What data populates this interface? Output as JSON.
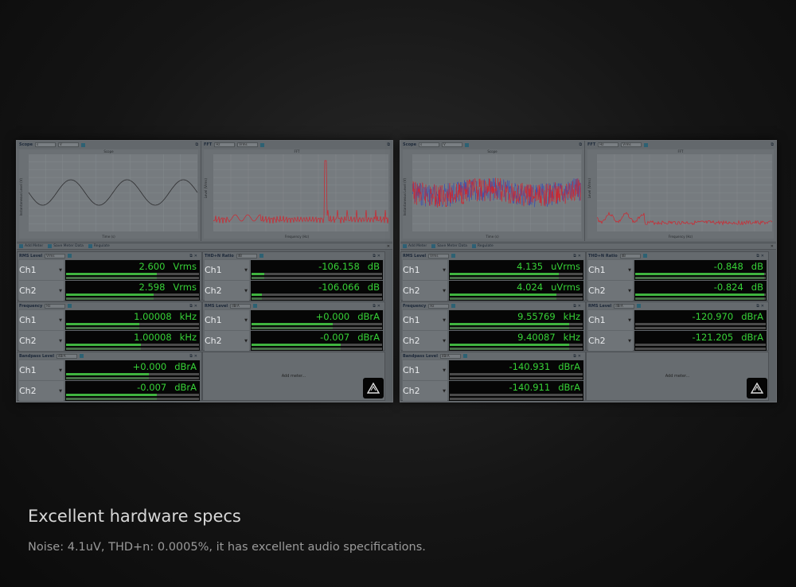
{
  "caption": {
    "title": "Excellent hardware specs",
    "subtitle": "Noise: 4.1uV, THD+n: 0.0005%,  it has excellent audio specifications."
  },
  "colors": {
    "meter_green": "#37d237",
    "bar_green": "#3fb43f",
    "trace_red": "#d0252e",
    "trace_blue": "#3a4fb0"
  },
  "toolbar": {
    "add_meter": "Add Meter",
    "save_meter_data": "Save Meter Data",
    "regulate": "Regulate"
  },
  "add_meter_placeholder": "Add meter...",
  "panels": [
    {
      "scope": {
        "title": "Scope",
        "unit1": "s",
        "unit2": "V",
        "chart_title": "Scope",
        "xlabel": "Time (s)",
        "ylabel": "Instantaneous Level (V)"
      },
      "fft": {
        "title": "FFT",
        "unit1": "Hz",
        "unit2": "Vrms",
        "chart_title": "FFT",
        "xlabel": "Frequency (Hz)",
        "ylabel": "Level (Vrms)"
      },
      "meters": {
        "rms": {
          "title": "RMS Level",
          "unit": "Vrms",
          "ch1": "2.600",
          "ch1_unit": "Vrms",
          "ch2": "2.598",
          "ch2_unit": "Vrms",
          "fill1": 0.68,
          "fill2": 0.66
        },
        "thd": {
          "title": "THD+N Ratio",
          "unit": "dB",
          "ch1": "-106.158",
          "ch1_unit": "dB",
          "ch2": "-106.066",
          "ch2_unit": "dB",
          "fill1": 0.1,
          "fill2": 0.08
        },
        "freq": {
          "title": "Frequency",
          "unit": "Hz",
          "ch1": "1.00008",
          "ch1_unit": "kHz",
          "ch2": "1.00008",
          "ch2_unit": "kHz",
          "fill1": 0.55,
          "fill2": 0.56
        },
        "rms2": {
          "title": "RMS Level",
          "unit": "dBrA",
          "ch1": "+0.000",
          "ch1_unit": "dBrA",
          "ch2": "-0.007",
          "ch2_unit": "dBrA",
          "fill1": 0.62,
          "fill2": 0.68
        },
        "bandpass": {
          "title": "Bandpass Level",
          "unit": "dBrA",
          "ch1": "+0.000",
          "ch1_unit": "dBrA",
          "ch2": "-0.007",
          "ch2_unit": "dBrA",
          "fill1": 0.62,
          "fill2": 0.68
        }
      }
    },
    {
      "scope": {
        "title": "Scope",
        "unit1": "s",
        "unit2": "V",
        "chart_title": "Scope",
        "xlabel": "Time (s)",
        "ylabel": "Instantaneous Level (V)"
      },
      "fft": {
        "title": "FFT",
        "unit1": "Hz",
        "unit2": "Vrms",
        "chart_title": "FFT",
        "xlabel": "Frequency (Hz)",
        "ylabel": "Level (Vrms)"
      },
      "meters": {
        "rms": {
          "title": "RMS Level",
          "unit": "Vrms",
          "ch1": "4.135",
          "ch1_unit": "uVrms",
          "ch2": "4.024",
          "ch2_unit": "uVrms",
          "fill1": 0.82,
          "fill2": 0.8
        },
        "thd": {
          "title": "THD+N Ratio",
          "unit": "dB",
          "ch1": "-0.848",
          "ch1_unit": "dB",
          "ch2": "-0.824",
          "ch2_unit": "dB",
          "fill1": 0.99,
          "fill2": 0.99
        },
        "freq": {
          "title": "Frequency",
          "unit": "Hz",
          "ch1": "9.55769",
          "ch1_unit": "kHz",
          "ch2": "9.40087",
          "ch2_unit": "kHz",
          "fill1": 0.9,
          "fill2": 0.9
        },
        "rms2": {
          "title": "RMS Level",
          "unit": "dBrA",
          "ch1": "-120.970",
          "ch1_unit": "dBrA",
          "ch2": "-121.205",
          "ch2_unit": "dBrA",
          "fill1": 0.0,
          "fill2": 0.0
        },
        "bandpass": {
          "title": "Bandpass Level",
          "unit": "dBrA",
          "ch1": "-140.931",
          "ch1_unit": "dBrA",
          "ch2": "-140.911",
          "ch2_unit": "dBrA",
          "fill1": 0.0,
          "fill2": 0.0
        }
      }
    }
  ],
  "channels": {
    "ch1": "Ch1",
    "ch2": "Ch2"
  }
}
